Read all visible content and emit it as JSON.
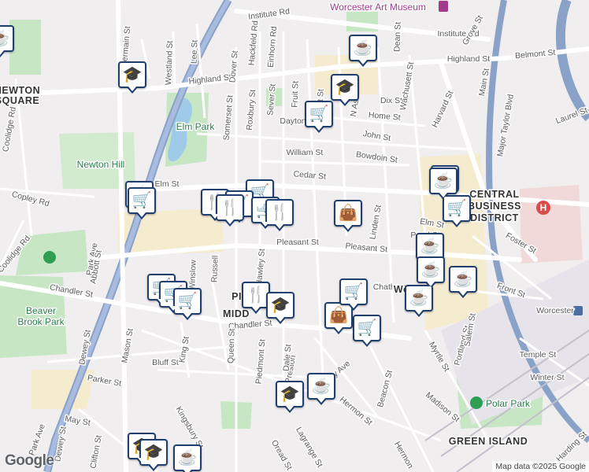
{
  "map": {
    "labels": {
      "streets": [
        "Institute Rd",
        "Institute Rd",
        "Highland St",
        "Highland St",
        "Belmont St",
        "Dix St",
        "Home St",
        "John St",
        "William St",
        "Bowdoin St",
        "Cedar St",
        "Elm St",
        "Elm St",
        "Copley Rd",
        "Pleasant St",
        "Pleasant St",
        "Chandler St",
        "Chandler St",
        "Park Ave",
        "Germain St",
        "Westland St",
        "Lee St",
        "Dover St",
        "Hackfeld Rd",
        "Einhorn Rd",
        "Roxbury St",
        "Somerset St",
        "Sever St",
        "Fruit St",
        "Dayton",
        "Dean St",
        "Wachusett St",
        "Harvard St",
        "Grove St",
        "Main St",
        "Major Taylor Blvd",
        "Laurel St",
        "Linden St",
        "Pearl St",
        "Foster St",
        "Front St",
        "Chatham",
        "Hawley St",
        "Russell",
        "Winslow",
        "Piedmont St",
        "Preston",
        "Dale St",
        "Murray Ave",
        "Hermon St",
        "Beacon St",
        "Madison St",
        "Myrtle St",
        "Portland St",
        "Salem St",
        "Temple St",
        "Winter St",
        "Harding St",
        "Bluff St",
        "Parker St",
        "Mason St",
        "Dewey St",
        "King St",
        "Queen St",
        "Kingsbury St",
        "Oread St",
        "Lagrange St",
        "May St",
        "Dewey St",
        "Abbott St",
        "Coolidge Rd",
        "Coolidge Rd",
        "N Ash",
        "Vest St",
        "Hermon",
        "Clifton St",
        "Park Ave"
      ],
      "areas": [
        "NEWTON",
        "SQUARE",
        "CENTRAL",
        "BUSINESS",
        "DISTRICT",
        "PIE",
        "MIDD",
        "GREEN ISLAND",
        "Wo"
      ],
      "parks": [
        "Elm Park",
        "Newton Hill",
        "Beaver",
        "Brook Park",
        "Polar Park"
      ],
      "pois": [
        "Worcester Art Museum",
        "Worcester"
      ]
    },
    "markers": [
      {
        "type": "coffee",
        "icon": "coffee-icon"
      },
      {
        "type": "school",
        "icon": "school-icon"
      },
      {
        "type": "school",
        "icon": "school-icon"
      },
      {
        "type": "shop",
        "icon": "cart-icon"
      },
      {
        "type": "coffee",
        "icon": "coffee-icon"
      },
      {
        "type": "coffee",
        "icon": "coffee-icon"
      },
      {
        "type": "coffee",
        "icon": "coffee-icon"
      },
      {
        "type": "shop",
        "icon": "cart-icon"
      },
      {
        "type": "coffee",
        "icon": "coffee-icon"
      },
      {
        "type": "shop",
        "icon": "cart-icon"
      },
      {
        "type": "shop",
        "icon": "cart-icon"
      },
      {
        "type": "restaurant",
        "icon": "fork-knife-icon"
      },
      {
        "type": "shop",
        "icon": "cart-icon"
      },
      {
        "type": "restaurant",
        "icon": "fork-knife-icon"
      },
      {
        "type": "shop",
        "icon": "cart-icon"
      },
      {
        "type": "restaurant",
        "icon": "fork-knife-icon"
      },
      {
        "type": "shopping-bag",
        "icon": "shopping-bag-icon"
      },
      {
        "type": "coffee",
        "icon": "coffee-icon"
      },
      {
        "type": "coffee",
        "icon": "coffee-icon"
      },
      {
        "type": "coffee",
        "icon": "coffee-icon"
      },
      {
        "type": "coffee",
        "icon": "coffee-icon"
      },
      {
        "type": "shop",
        "icon": "cart-icon"
      },
      {
        "type": "shop",
        "icon": "cart-icon"
      },
      {
        "type": "shop",
        "icon": "cart-icon"
      },
      {
        "type": "restaurant",
        "icon": "fork-knife-icon"
      },
      {
        "type": "school",
        "icon": "school-icon"
      },
      {
        "type": "shopping-bag",
        "icon": "shopping-bag-icon"
      },
      {
        "type": "shop",
        "icon": "cart-icon"
      },
      {
        "type": "shop",
        "icon": "cart-icon"
      },
      {
        "type": "school",
        "icon": "school-icon"
      },
      {
        "type": "coffee",
        "icon": "coffee-icon"
      },
      {
        "type": "school",
        "icon": "school-icon"
      },
      {
        "type": "school",
        "icon": "school-icon"
      },
      {
        "type": "coffee",
        "icon": "coffee-icon"
      }
    ]
  },
  "branding": {
    "logo": "Google",
    "attribution": "Map data ©2025 Google"
  },
  "colors": {
    "marker_border": "#1f3f6e",
    "highway": "#8aa2c8",
    "park": "#c7e6c4",
    "commercial": "#f5ecd0",
    "road": "#ffffff"
  }
}
